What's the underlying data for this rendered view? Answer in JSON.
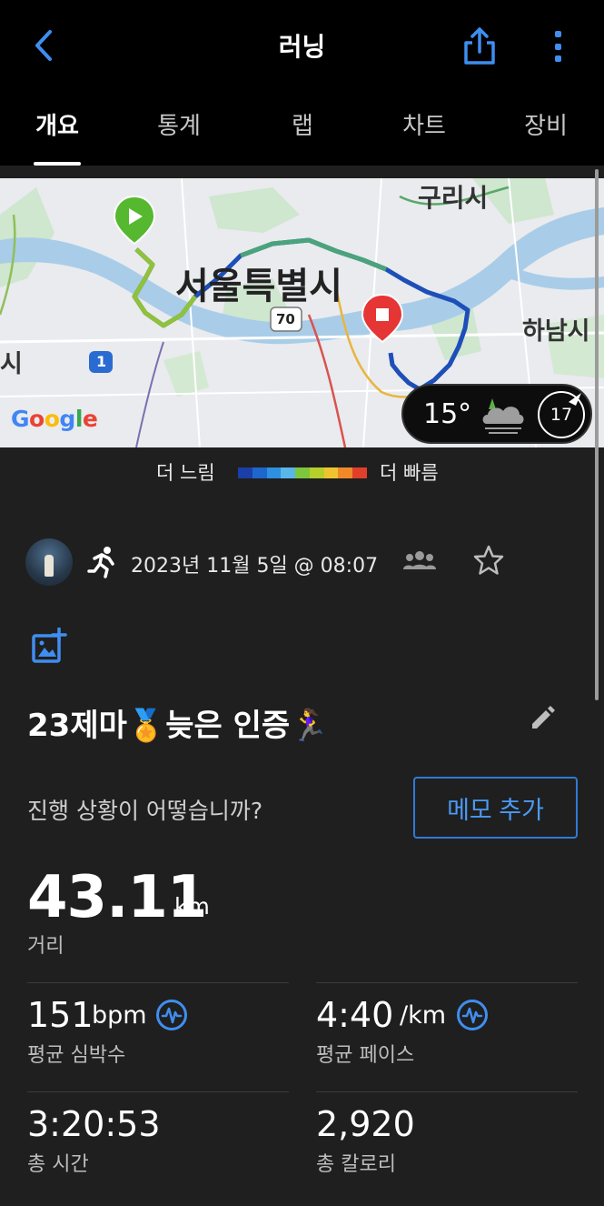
{
  "header": {
    "title": "러닝",
    "back_icon": "chevron-left-icon",
    "share_icon": "share-icon",
    "more_icon": "more-vertical-icon"
  },
  "tabs": [
    {
      "label": "개요",
      "active": true
    },
    {
      "label": "통계",
      "active": false
    },
    {
      "label": "랩",
      "active": false
    },
    {
      "label": "차트",
      "active": false
    },
    {
      "label": "장비",
      "active": false
    }
  ],
  "map": {
    "labels": {
      "guri": "구리시",
      "seoul": "서울특별시",
      "hanam": "하남시",
      "partial_left": "시",
      "road_70": "70",
      "road_1": "1"
    },
    "google_logo": "Google",
    "weather": {
      "temperature": "15°",
      "icon": "cloud-fog-icon",
      "wind_speed": "17"
    }
  },
  "legend": {
    "slow_label": "더 느림",
    "fast_label": "더 빠름",
    "colors": [
      "#1b3fa8",
      "#1e66cc",
      "#2f8fe0",
      "#59b6e9",
      "#7ec63c",
      "#b5cf2b",
      "#f0c430",
      "#f08a28",
      "#e0402a"
    ]
  },
  "activity": {
    "type_icon": "running-icon",
    "date": "2023년 11월 5일 @ 08:07",
    "group_icon": "group-icon",
    "favorite_icon": "star-icon",
    "add_photo_icon": "add-photo-icon",
    "name": "23제마🏅늦은 인증🏃‍♀️",
    "edit_icon": "pencil-icon"
  },
  "notes": {
    "prompt": "진행 상황이 어떻습니까?",
    "memo_button": "메모 추가"
  },
  "distance": {
    "value": "43.11",
    "unit": "km",
    "label": "거리"
  },
  "stats": {
    "avg_hr": {
      "value": "151",
      "unit": "bpm",
      "label": "평균 심박수"
    },
    "avg_pace": {
      "value": "4:40",
      "unit": "/km",
      "label": "평균 페이스"
    },
    "total_time": {
      "value": "3:20:53",
      "label": "총 시간"
    },
    "total_calories": {
      "value": "2,920",
      "label": "총 칼로리"
    }
  },
  "colors": {
    "accent": "#3f8ef0",
    "background": "#1f1f1f",
    "header": "#000000"
  }
}
